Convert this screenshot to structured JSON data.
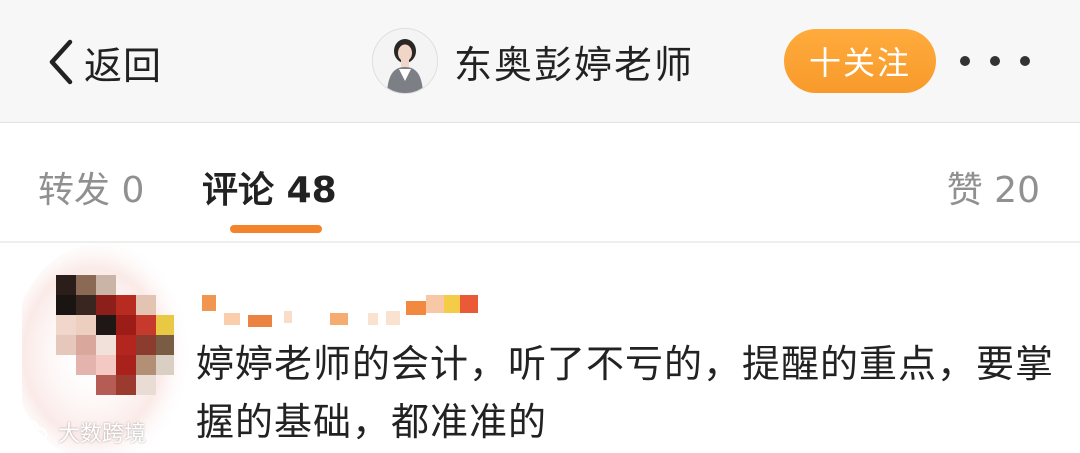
{
  "header": {
    "back_label": "返回",
    "title": "东奥彭婷老师",
    "follow_label": "十关注"
  },
  "tabs": {
    "repost": "转发 0",
    "comment": "评论 48",
    "like": "赞 20"
  },
  "comment": {
    "text": "婷婷老师的会计，听了不亏的，提醒的重点，要掌握的基础，都准准的"
  },
  "watermark": {
    "text": "大数跨境"
  },
  "colors": {
    "accent": "#f5832a",
    "follow_button": "#f79a2b",
    "header_bg": "#f7f7f7",
    "tab_inactive": "#909090"
  },
  "icons": {
    "back": "chevron-left-icon",
    "more": "more-dots-icon"
  }
}
